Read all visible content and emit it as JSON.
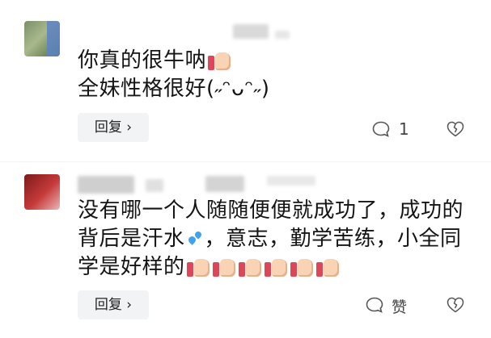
{
  "comments": [
    {
      "lines": [
        "你真的很牛呐",
        "全妹性格很好(˶ᵔᴗᵔ˶)"
      ],
      "reply_label": "回复 ›",
      "like_count": "1"
    },
    {
      "lines": [
        "没有哪一个人随随便便就成功了，成功的",
        "背后是汗水",
        "，意志，勤学苦练，小全同",
        "学是好样的"
      ],
      "reply_label": "回复 ›",
      "like_label": "赞"
    }
  ],
  "icons": [
    "chat-bubble-icon",
    "broken-heart-icon",
    "thumbs-up-emoji",
    "sweat-droplets-emoji"
  ]
}
